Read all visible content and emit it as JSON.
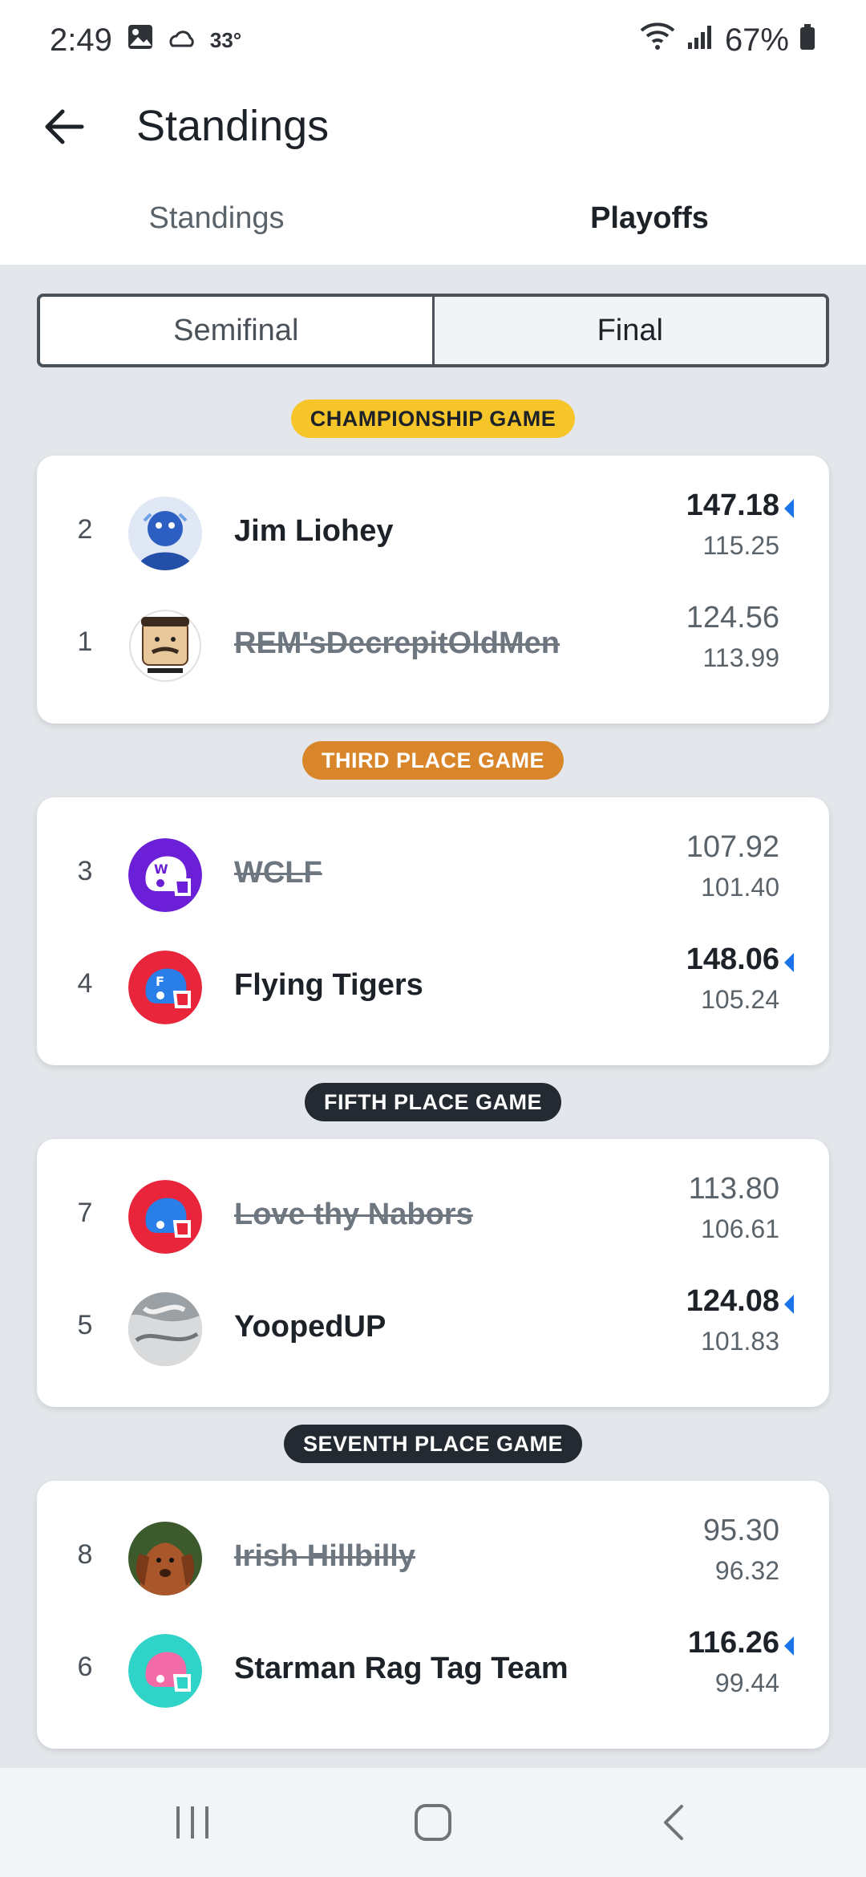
{
  "status_bar": {
    "time": "2:49",
    "temperature": "33°",
    "battery": "67%",
    "icons": [
      "gallery-icon",
      "cloud-icon",
      "wifi-icon",
      "signal-icon",
      "battery-icon"
    ]
  },
  "header": {
    "title": "Standings",
    "back_icon": "arrow-left-icon"
  },
  "tabs": [
    {
      "label": "Standings",
      "active": false
    },
    {
      "label": "Playoffs",
      "active": true
    }
  ],
  "segments": [
    {
      "label": "Semifinal",
      "active": false
    },
    {
      "label": "Final",
      "active": true
    }
  ],
  "games": [
    {
      "label": "CHAMPIONSHIP GAME",
      "label_bg": "#f6c529",
      "label_color": "#1d2228",
      "teams": [
        {
          "seed": "2",
          "name": "Jim Liohey",
          "score": "147.18",
          "projected": "115.25",
          "winner": true,
          "avatar": "photo"
        },
        {
          "seed": "1",
          "name": "REM'sDecrepitOldMen",
          "score": "124.56",
          "projected": "113.99",
          "winner": false,
          "avatar": "cartoon"
        }
      ]
    },
    {
      "label": "THIRD PLACE GAME",
      "label_bg": "#d9852a",
      "label_color": "#ffffff",
      "teams": [
        {
          "seed": "3",
          "name": "WCLF",
          "score": "107.92",
          "projected": "101.40",
          "winner": false,
          "avatar": "helmet-purple"
        },
        {
          "seed": "4",
          "name": "Flying Tigers",
          "score": "148.06",
          "projected": "105.24",
          "winner": true,
          "avatar": "helmet-red"
        }
      ]
    },
    {
      "label": "FIFTH PLACE GAME",
      "label_bg": "#232a31",
      "label_color": "#ffffff",
      "teams": [
        {
          "seed": "7",
          "name": "Love thy Nabors",
          "score": "113.80",
          "projected": "106.61",
          "winner": false,
          "avatar": "helmet-red-blue"
        },
        {
          "seed": "5",
          "name": "YoopedUP",
          "score": "124.08",
          "projected": "101.83",
          "winner": true,
          "avatar": "photo-gray"
        }
      ]
    },
    {
      "label": "SEVENTH PLACE GAME",
      "label_bg": "#232a31",
      "label_color": "#ffffff",
      "teams": [
        {
          "seed": "8",
          "name": "Irish Hillbilly",
          "score": "95.30",
          "projected": "96.32",
          "winner": false,
          "avatar": "photo-dog"
        },
        {
          "seed": "6",
          "name": "Starman Rag Tag Team",
          "score": "116.26",
          "projected": "99.44",
          "winner": true,
          "avatar": "helmet-teal"
        }
      ]
    }
  ],
  "colors": {
    "accent": "#1a73e8",
    "background": "#e3e6ea",
    "card": "#ffffff"
  },
  "nav": [
    "recents-icon",
    "home-icon",
    "back-icon"
  ]
}
